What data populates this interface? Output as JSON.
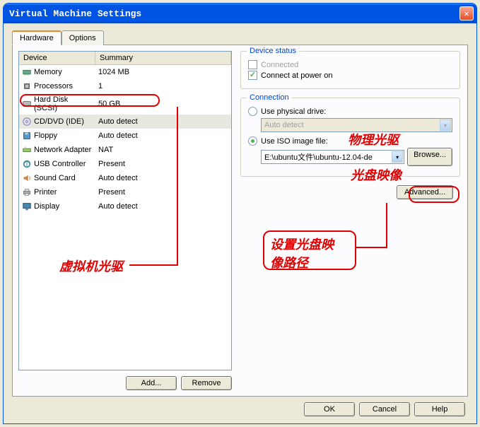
{
  "window": {
    "title": "Virtual Machine Settings"
  },
  "tabs": {
    "hardware": "Hardware",
    "options": "Options"
  },
  "list": {
    "header": {
      "device": "Device",
      "summary": "Summary"
    },
    "rows": [
      {
        "name": "Memory",
        "summary": "1024 MB"
      },
      {
        "name": "Processors",
        "summary": "1"
      },
      {
        "name": "Hard Disk (SCSI)",
        "summary": "50 GB"
      },
      {
        "name": "CD/DVD (IDE)",
        "summary": "Auto detect"
      },
      {
        "name": "Floppy",
        "summary": "Auto detect"
      },
      {
        "name": "Network Adapter",
        "summary": "NAT"
      },
      {
        "name": "USB Controller",
        "summary": "Present"
      },
      {
        "name": "Sound Card",
        "summary": "Auto detect"
      },
      {
        "name": "Printer",
        "summary": "Present"
      },
      {
        "name": "Display",
        "summary": "Auto detect"
      }
    ]
  },
  "left_buttons": {
    "add": "Add...",
    "remove": "Remove"
  },
  "device_status": {
    "legend": "Device status",
    "connected": "Connected",
    "connect_power_on": "Connect at power on"
  },
  "connection": {
    "legend": "Connection",
    "use_physical": "Use physical drive:",
    "physical_value": "Auto detect",
    "use_iso": "Use ISO image file:",
    "iso_value": "E:\\ubuntu文件\\ubuntu-12.04-de",
    "browse": "Browse...",
    "advanced": "Advanced..."
  },
  "bottom": {
    "ok": "OK",
    "cancel": "Cancel",
    "help": "Help"
  },
  "annotations": {
    "vm_drive": "虚拟机光驱",
    "physical": "物理光驱",
    "iso": "光盘映像",
    "set_path": "设置光盘映\n像路径"
  }
}
